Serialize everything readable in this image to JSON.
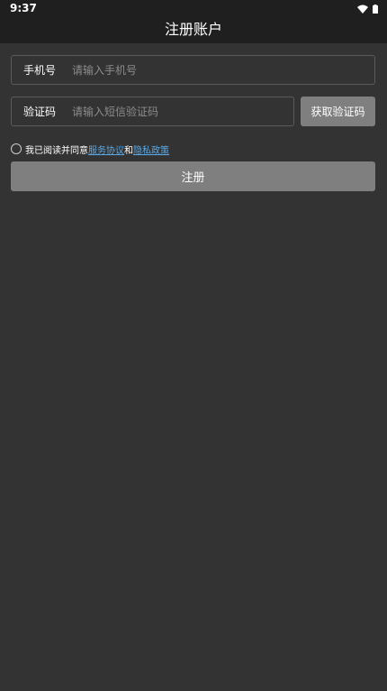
{
  "status_bar": {
    "time": "9:37",
    "icons": [
      "wifi-icon",
      "battery-icon"
    ]
  },
  "header": {
    "title": "注册账户"
  },
  "form": {
    "phone": {
      "label": "手机号",
      "placeholder": "请输入手机号",
      "value": ""
    },
    "code": {
      "label": "验证码",
      "placeholder": "请输入短信验证码",
      "value": ""
    },
    "get_code_label": "获取验证码",
    "agreement": {
      "checked": false,
      "prefix": "我已阅读并同意",
      "service_link": "服务协议",
      "conjunction": "和",
      "privacy_link": "隐私政策"
    },
    "register_label": "注册"
  },
  "colors": {
    "background": "#333333",
    "app_bar": "#1f1f1f",
    "button": "#7f7f7f",
    "link": "#5aa9e6",
    "placeholder": "#8c8c8c",
    "border": "#5a5a5a"
  }
}
